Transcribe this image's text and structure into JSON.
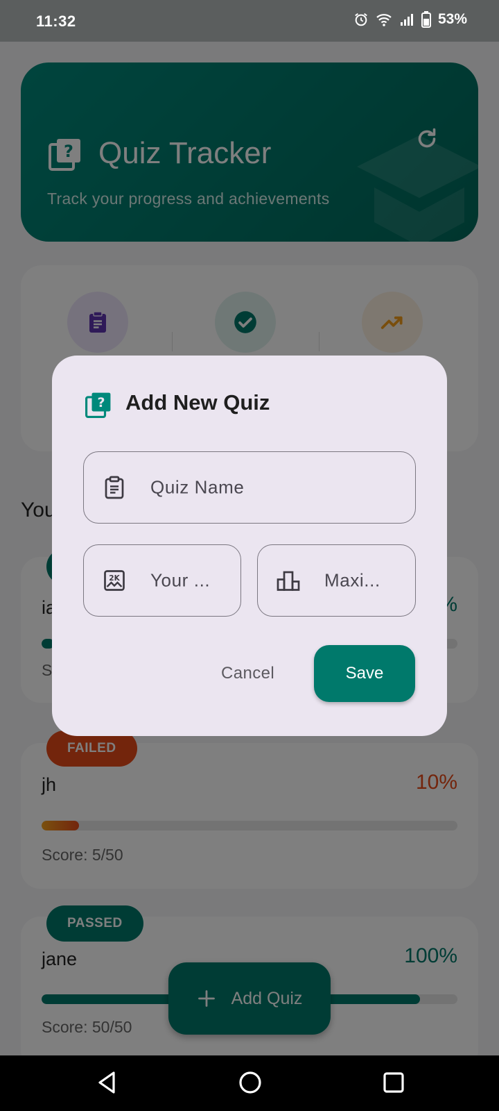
{
  "status_bar": {
    "time": "11:32",
    "battery_percent": "53%",
    "icons": [
      "alarm-icon",
      "wifi-icon",
      "signal-icon",
      "battery-icon"
    ]
  },
  "header": {
    "title": "Quiz Tracker",
    "subtitle": "Track your progress and achievements",
    "icons": [
      "quiz-icon",
      "refresh-icon",
      "graduation-cap-icon"
    ]
  },
  "stats": {
    "icons": [
      "clipboard-icon",
      "check-circle-icon",
      "trending-up-icon"
    ]
  },
  "section_title": "You",
  "quizzes": [
    {
      "badge": "",
      "name": "ia",
      "percent": "%",
      "score": "S",
      "progress": 0.03
    },
    {
      "badge": "FAILED",
      "name": "jh",
      "percent": "10%",
      "score": "Score: 5/50",
      "progress": 0.1
    },
    {
      "badge": "PASSED",
      "name": "jane",
      "percent": "100%",
      "score": "Score: 50/50",
      "progress": 1.0
    }
  ],
  "fab": {
    "label": "Add Quiz",
    "icon": "plus-icon"
  },
  "dialog": {
    "title": "Add New Quiz",
    "fields": {
      "quiz_name": "Quiz Name",
      "your_score": "Your ...",
      "max_score": "Maxi..."
    },
    "cancel": "Cancel",
    "save": "Save"
  },
  "nav": {
    "icons": [
      "back-icon",
      "home-icon",
      "recents-icon"
    ]
  },
  "colors": {
    "primary": "#00796b",
    "failed": "#e64a19",
    "passed": "#00796b",
    "dialog_bg": "#ebe5f0"
  }
}
